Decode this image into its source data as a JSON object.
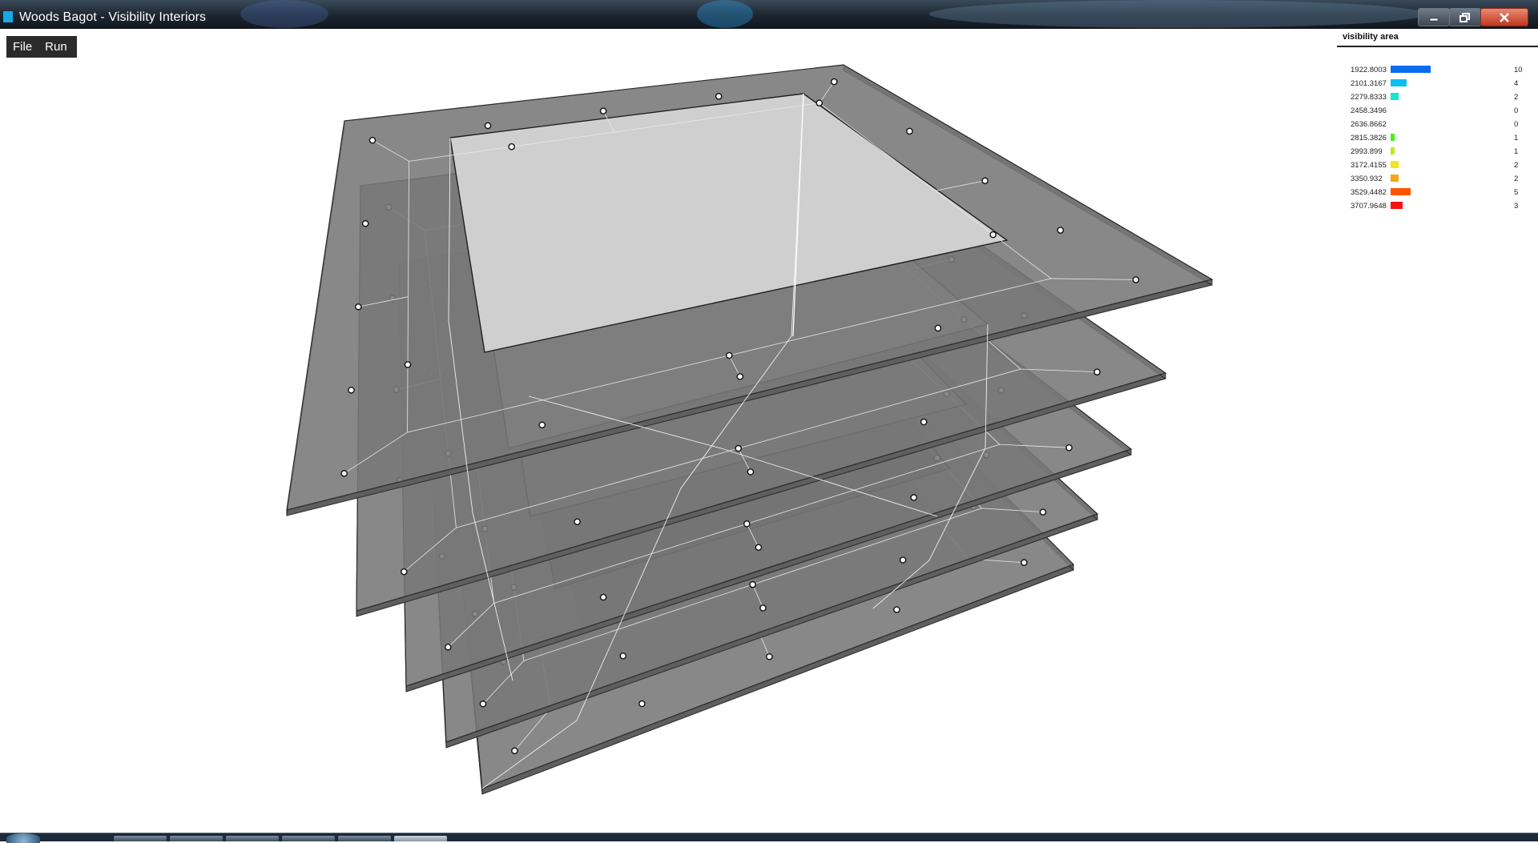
{
  "window": {
    "title": "Woods Bagot - Visibility Interiors"
  },
  "menu": {
    "items": [
      "File",
      "Run"
    ]
  },
  "legend": {
    "title": "visibility area",
    "rows": [
      {
        "value": "1922.8003",
        "count": "10",
        "color": "#0a6cf0"
      },
      {
        "value": "2101.3167",
        "count": "4",
        "color": "#0ac0f0"
      },
      {
        "value": "2279.8333",
        "count": "2",
        "color": "#14e6d2"
      },
      {
        "value": "2458.3496",
        "count": "0",
        "color": "#26e29a"
      },
      {
        "value": "2636.8662",
        "count": "0",
        "color": "#3ee65a"
      },
      {
        "value": "2815.3826",
        "count": "1",
        "color": "#4cf01e"
      },
      {
        "value": "2993.899",
        "count": "1",
        "color": "#b4f01e"
      },
      {
        "value": "3172.4155",
        "count": "2",
        "color": "#f0e61e"
      },
      {
        "value": "3350.932",
        "count": "2",
        "color": "#f5a41e"
      },
      {
        "value": "3529.4482",
        "count": "5",
        "color": "#ff5500"
      },
      {
        "value": "3707.9648",
        "count": "3",
        "color": "#f51414"
      }
    ]
  },
  "scene": {
    "floor_count": 5,
    "floor_fill": "#777777",
    "atrium_shades": [
      "#cfcfcf",
      "#a8a8a8",
      "#8e8e8e",
      "#5a5a5a",
      "#3f3f3f"
    ]
  }
}
